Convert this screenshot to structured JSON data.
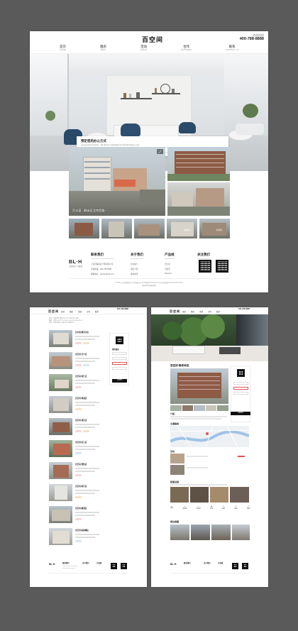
{
  "brand": {
    "logo": "百空间",
    "phone_label": "咨询热线",
    "phone": "400-788-8888",
    "footer_logo_main": "BL·H",
    "footer_logo_sub": "百联商业广场集团"
  },
  "nav": [
    {
      "label": "首页",
      "sub": "HOME"
    },
    {
      "label": "租房",
      "sub": "RENT"
    },
    {
      "label": "活动",
      "sub": "EVENT"
    },
    {
      "label": "合作",
      "sub": "PARTNERS"
    },
    {
      "label": "联系",
      "sub": "CONTACT US"
    }
  ],
  "hero_form": {
    "title": "预定您的办公方式",
    "description": "请在此处填写您的需求，我们将尽快与您取得联系并为您提供专属办公方案",
    "name_placeholder": "您的称呼",
    "phone_placeholder": "电话号码",
    "company_placeholder": "公司名称",
    "area_placeholder": "面积需求",
    "error": "请输入正确的手机号",
    "submit": "提交"
  },
  "gallery": {
    "main_caption": "百丰荟 · 静安区北京西路 ···",
    "thumbs": [
      "",
      "",
      "",
      "嘉里中心",
      "新天地"
    ]
  },
  "footer": {
    "contact": {
      "title": "联系我们",
      "rows": [
        "上海百联商业广场有限公司",
        "咨询热线：400-788-8888",
        "邮箱地址：partner@blh.com"
      ]
    },
    "about": {
      "title": "关于我们",
      "rows": [
        "企业简介",
        "团队介绍",
        "最新资讯"
      ]
    },
    "products": {
      "title": "产品线",
      "rows": [
        "百空间",
        "百商务",
        "BLspace"
      ]
    },
    "follow": {
      "title": "关注我们"
    },
    "copyright": "© 2021 上海百联商业广场有限公司 沪ICP备XXXXXXXX号 沪公网安备XXXXXXXXXXXX号",
    "links": "网站声明   隐私政策"
  },
  "listing_page": {
    "filters": [
      "区域：不限  静安  黄浦  徐汇  长宁  浦东  虹口  普陀",
      "面积：不限  50㎡以下  50-100㎡  100-200㎡  200㎡以上",
      "类型：不限  联合办公  独立办公  整层办公"
    ],
    "items": [
      {
        "title": "百丰荟·静安寺店"
      },
      {
        "title": "百空间·长宁店"
      },
      {
        "title": "百空间·徐汇店"
      },
      {
        "title": "百空间·黄浦店"
      },
      {
        "title": "百空间·浦东店"
      },
      {
        "title": "百空间·虹口店"
      },
      {
        "title": "百空间·普陀店"
      },
      {
        "title": "百空间·闵行店"
      },
      {
        "title": "百空间·杨浦店"
      },
      {
        "title": "百空间·陆家嘴店"
      }
    ],
    "side_title": "预约看房",
    "side_button": "立即预约"
  },
  "detail_page": {
    "title": "百空间·静安寺店",
    "sections": [
      "介绍",
      "交通路线",
      "空间",
      "配套设施",
      "周边商圈"
    ],
    "amenity_labels": [
      "WiFi",
      "会议室",
      "茶水间",
      "打印",
      "前台",
      "停车",
      "安保"
    ],
    "side_button": "立即预约"
  },
  "colors": {
    "accent_red": "#e05353",
    "dark": "#111111",
    "chair_blue": "#2b4a6a"
  }
}
